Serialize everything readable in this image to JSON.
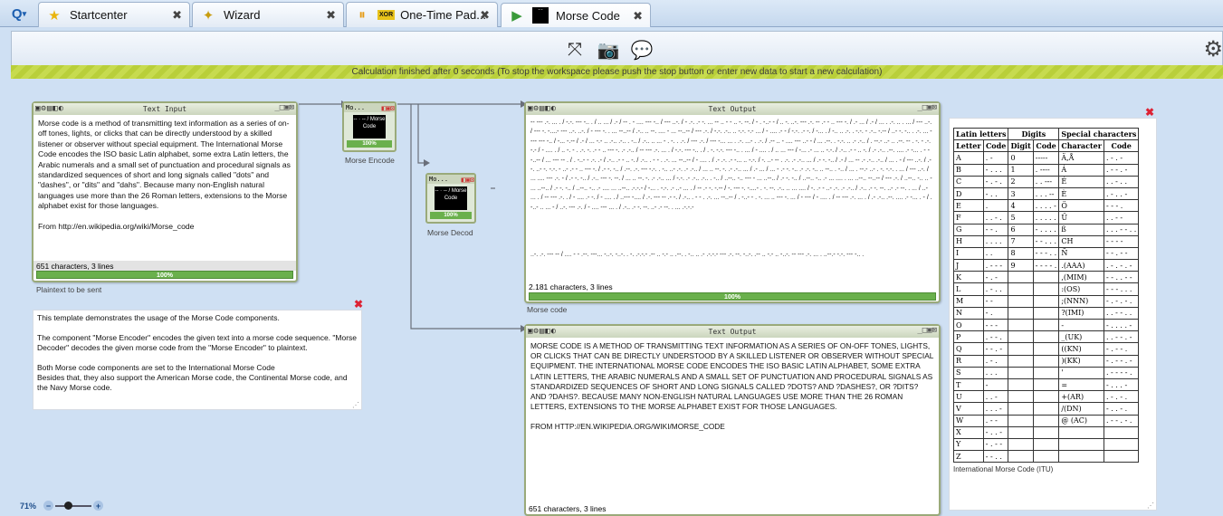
{
  "tabs": [
    {
      "label": "Startcenter",
      "icon": "star-icon",
      "active": false
    },
    {
      "label": "Wizard",
      "icon": "wand-icon",
      "active": false
    },
    {
      "label": "One-Time Pad...",
      "icon": "pause-icon",
      "active": false
    },
    {
      "label": "Morse Code",
      "icon": "play-icon",
      "active": true
    }
  ],
  "close_glyph": "✖",
  "status": "Calculation finished after 0 seconds (To stop the workspace please push the stop button or enter new data to start a new calculation)",
  "text_input": {
    "title": "Text Input",
    "body": "Morse code is a method of transmitting text information as a series of on-off tones, lights, or clicks that can be directly understood by a skilled listener or observer without special equipment. The International Morse Code encodes the ISO basic Latin alphabet, some extra Latin letters, the Arabic numerals and a small set of punctuation and procedural signals as standardized sequences of short and long signals called \"dots\" and \"dashes\", or \"dits\" and \"dahs\". Because many non-English natural languages use more than the 26 Roman letters, extensions to the Morse alphabet exist for those languages.",
    "source": "From http://en.wikipedia.org/wiki/Morse_code",
    "footer": "651 characters,  3 lines",
    "progress": "100%",
    "caption": "Plaintext to be sent"
  },
  "encoder": {
    "title": "Mo...",
    "icon_text": "-- · -- / Morse Code",
    "progress": "100%",
    "caption": "Morse Encode"
  },
  "decoder": {
    "title": "Mo...",
    "icon_text": "-- · -- / Morse Code",
    "progress": "100%",
    "caption": "Morse Decod"
  },
  "text_output_1": {
    "title": "Text Output",
    "body": "-- --- .-. ... . / -.-. --- -.. . / .. ... / .- / -- . - .... --- -.. / --- ..-. / - .-. .- -. ... -- .. - - .. -. --. / - . -..- - / .. -. ..-. --- .-. -- .- - .. --- -. / .- ... / .- / ... . .-. .. . ... / --- ..-. / --- -. -....- --- ..-. ..-. / - --- -. . ... --..-- / .-.. .. --. .... - ... --..-- / --- .-. / -.-. .-.. .. -.-. -.- ... / - .... .- - / -.-. .- -. / -... . / -.. .. .-. . -.-. - .-.. -.-- / ..- -. -.. . .-. ... - --- --- -.. / -... -.-- / .- / ... -.- .. .-.. .-.. . -.. / .-.. .. ... - . -. . .-. / --- .-. / --- -... ... . .-. ...- . .-. / .-- .. - .... --- ..- - / ... .--. . -.-. .. .- .-.. / . --.- ..- .. .--. -- . -. - .-.-.- / - .... . / .. -. - . .-. -. .- - .. --- -. .- .-.. / -- --- .-. ... . / -.-. --- -.. . / . -. -.-. --- -.. . ... / - .... . / .. ... --- / -... .- ... .. -.-. / .-.. .- - .. -. / .- .-.. .--. .... .- -... . - --..-- / ... --- -- . / . -..- - .-. .- / .-.. .- - .. -. / .-.. . - - . .-. ... --..-- / - .... . / .- .-. .- -... .. -.-. / -. ..- -- . .-. .- .-.. ... / .- -. -.. / .- / ... -- .- .-.. .-.. / ... . - / --- ..-. / .--. ..- -. -.-. - ..- .- - .. --- -. / .- -. -.. / .--. .-. --- -.-. . -.. ..- .-. .- .-.. / ... .. --. -. .- .-.. ... / .- ... / ... - .- -. -.. .- .-. -.. .. --.. . -.. / ... . --.- ..- . -. -.-. . ... / --- ..-. / ... .... --- .-. - / .- -. -.. / .-.. --- -. --. / ... .. --. -. .- .-.. ... / -.-. .- .-.. .-.. . -.. / ..--.. -.. --- - ... ..--.. / .- -. -.. / ..--.. -.. .- ... .... . ... ..--.. --..-- / --- .-. / ..--.. -.. .. - ... ..--.. / .- -. -.. / ..--.. -.. .- .... ... ..--.. .-.-.- / -... . -.-. .- ..- ... . / -- .- -. -.-- / -. --- -. -....- . -. --. .-.. .. ... .... / -. .- - ..- .-. .- .-.. / .-.. .- -. --. ..- .- --. . ... / ..- ... . / -- --- .-. . / - .... .- -. / - .... . / ..--- -.... / .-. --- -- .- -. / .-.. . - - . .-. ... --..-- / . -..- - . -. ... .. --- -. ... / - --- / - .... . / -- --- .-. ... . / .- .-.. .--. .... .- -... . - / . -..- .. ... - / ..-. --- .-. / - .... --- ... . / .-.. .- -. --. ..- .- --. . ... .-.-.-",
    "body2": "..-. .-. --- -- / .... - - .--. ---... -..-. -..-. . -. .-.-.- .-- .. -.- .. .--. . -.. .. .- .-.-.- --- .-. --. -..-. .-- .. -.- .. -..-. -- --- .-. ... . ..--.- -.-. --- -.. .",
    "footer": "2.181 characters,  3 lines",
    "progress": "100%",
    "caption": "Morse code"
  },
  "text_output_2": {
    "title": "Text Output",
    "body": "MORSE CODE IS A METHOD OF TRANSMITTING TEXT INFORMATION AS A SERIES OF ON-OFF TONES, LIGHTS, OR CLICKS THAT CAN BE DIRECTLY UNDERSTOOD BY A SKILLED LISTENER OR OBSERVER WITHOUT SPECIAL EQUIPMENT. THE INTERNATIONAL MORSE CODE ENCODES THE ISO BASIC LATIN ALPHABET, SOME EXTRA LATIN LETTERS, THE ARABIC NUMERALS AND A SMALL SET OF PUNCTUATION AND PROCEDURAL SIGNALS AS STANDARDIZED SEQUENCES OF SHORT AND LONG SIGNALS CALLED ?DOTS? AND ?DASHES?, OR ?DITS? AND ?DAHS?. BECAUSE MANY NON-ENGLISH NATURAL LANGUAGES USE MORE THAN THE 26 ROMAN LETTERS, EXTENSIONS TO THE MORSE ALPHABET EXIST FOR THOSE LANGUAGES.",
    "source": "FROM HTTP://EN.WIKIPEDIA.ORG/WIKI/MORSE_CODE",
    "footer": "651 characters,  3 lines"
  },
  "note": {
    "line1": "This template demonstrates the usage of the Morse Code components.",
    "line2": "The component \"Morse Encoder\" encodes the given text into a morse code sequence. \"Morse Decoder\" decodes the given morse code from the \"Morse Encoder\" to plaintext.",
    "line3": "Both Morse code components are set to the International Morse Code",
    "line4": "Besides that, they also support the American Morse code, the Continental Morse code, and the Navy Morse code."
  },
  "morse_table": {
    "group_headers": [
      "Latin letters",
      "Digits",
      "Special characters"
    ],
    "col_headers": [
      "Letter",
      "Code",
      "Digit",
      "Code",
      "Character",
      "Code"
    ],
    "rows": [
      [
        "A",
        ". -",
        "0",
        "-----",
        "Ä,Å",
        ". - . -"
      ],
      [
        "B",
        "- . . .",
        "1",
        ". ----",
        "Á",
        ". - - . -"
      ],
      [
        "C",
        "- . - .",
        "2",
        ". . ---",
        "É",
        ". . - . ."
      ],
      [
        "D",
        "- . .",
        "3",
        ". . . --",
        "È",
        ". - . . -"
      ],
      [
        "E",
        ".",
        "4",
        ". . . . -",
        "Ö",
        "- - - ."
      ],
      [
        "F",
        ". . - .",
        "5",
        ". . . . .",
        "Ü",
        ". . - -"
      ],
      [
        "G",
        "- - .",
        "6",
        "- . . . .",
        "ß",
        ". . . - - . ."
      ],
      [
        "H",
        ". . . .",
        "7",
        "- - . . .",
        "CH",
        "- - - -"
      ],
      [
        "I",
        ". .",
        "8",
        "- - - . .",
        "Ñ",
        "- - . - -"
      ],
      [
        "J",
        ". - - -",
        "9",
        "- - - - .",
        ".(AAA)",
        ". - . - . -"
      ],
      [
        "K",
        "- . -",
        "",
        "",
        ",(MIM)",
        "- - . . - -"
      ],
      [
        "L",
        ". - . .",
        "",
        "",
        ":(OS)",
        "- - - . . ."
      ],
      [
        "M",
        "- -",
        "",
        "",
        ";(NNN)",
        "- . - . - ."
      ],
      [
        "N",
        "- .",
        "",
        "",
        "?(IMI)",
        ". . - - . ."
      ],
      [
        "O",
        "- - -",
        "",
        "",
        "-",
        "- . . . . -"
      ],
      [
        "P",
        ". - - .",
        "",
        "",
        "_(UK)",
        ". . - - . -"
      ],
      [
        "Q",
        "- - . -",
        "",
        "",
        "((KN)",
        "- . - - ."
      ],
      [
        "R",
        ". - .",
        "",
        "",
        ")(KK)",
        "- . - - . -"
      ],
      [
        "S",
        ". . .",
        "",
        "",
        "'",
        ". - - - - ."
      ],
      [
        "T",
        "-",
        "",
        "",
        "=",
        "- . . . -"
      ],
      [
        "U",
        ". . -",
        "",
        "",
        "+(AR)",
        ". - . - ."
      ],
      [
        "V",
        ". . . -",
        "",
        "",
        "/(DN)",
        "- . . - ."
      ],
      [
        "W",
        ". - -",
        "",
        "",
        "@ (AC)",
        ". - - . - ."
      ],
      [
        "X",
        "- . . -",
        "",
        "",
        "",
        ""
      ],
      [
        "Y",
        "- . - -",
        "",
        "",
        "",
        ""
      ],
      [
        "Z",
        "- - . .",
        "",
        "",
        "",
        ""
      ]
    ],
    "caption": "International Morse Code (ITU)"
  },
  "zoom": "71%"
}
